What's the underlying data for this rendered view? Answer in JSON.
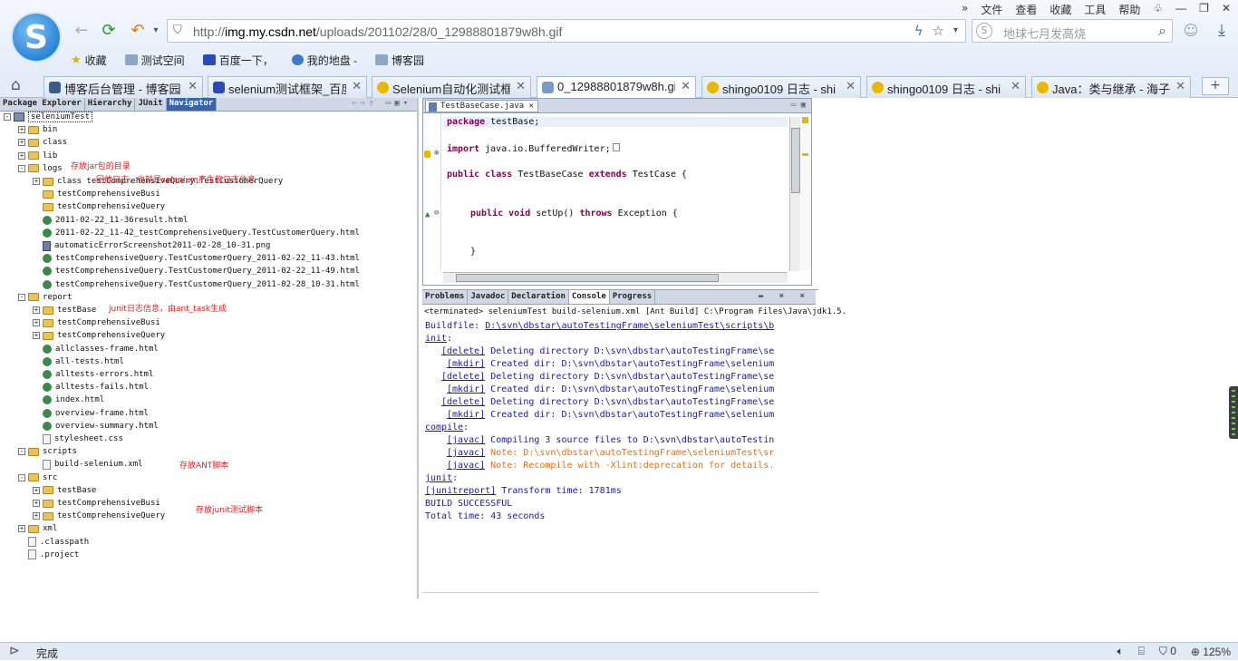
{
  "menu": {
    "items": [
      "文件",
      "查看",
      "收藏",
      "工具",
      "帮助"
    ]
  },
  "address": {
    "host_prefix": "http://",
    "host": "img.my.csdn.net",
    "path": "/uploads/201102/28/0_12988801879w8h.gif"
  },
  "search": {
    "placeholder": "地球七月发高烧"
  },
  "favorites": [
    "收藏",
    "测试空间",
    "百度一下，",
    "我的地盘 -",
    "博客园"
  ],
  "tabs": [
    {
      "label": "博客后台管理 - 博客园",
      "icon_color": "#3a5a8a"
    },
    {
      "label": "selenium测试框架_百度",
      "icon_color": "#2a4ab8"
    },
    {
      "label": "Selenium自动化测试框",
      "icon_color": "#e6b800"
    },
    {
      "label": "0_12988801879w8h.gi",
      "icon_color": "#7a9ac8"
    },
    {
      "label": "shingo0109 日志 - shi",
      "icon_color": "#e6b800"
    },
    {
      "label": "shingo0109 日志 - shi",
      "icon_color": "#e6b800"
    },
    {
      "label": "Java：类与继承 - 海子",
      "icon_color": "#e6b800"
    }
  ],
  "eclipse": {
    "left_tabs": [
      "Package Explorer",
      "Hierarchy",
      "JUnit",
      "Navigator"
    ],
    "tree": [
      {
        "label": "seleniumTest",
        "depth": 0,
        "icon": "project",
        "toggle": "-"
      },
      {
        "label": "bin",
        "depth": 1,
        "icon": "folder",
        "toggle": "+"
      },
      {
        "label": "class",
        "depth": 1,
        "icon": "folder",
        "toggle": "+"
      },
      {
        "label": "lib",
        "depth": 1,
        "icon": "folder",
        "toggle": "+"
      },
      {
        "label": "logs",
        "depth": 1,
        "icon": "folder",
        "toggle": "-"
      },
      {
        "label": "class testComprehensiveQuery.TestCustomerQuery",
        "depth": 2,
        "icon": "folder",
        "toggle": "+"
      },
      {
        "label": "testComprehensiveBusi",
        "depth": 2,
        "icon": "folder",
        "toggle": ""
      },
      {
        "label": "testComprehensiveQuery",
        "depth": 2,
        "icon": "folder",
        "toggle": ""
      },
      {
        "label": "2011-02-22_11-36result.html",
        "depth": 2,
        "icon": "globe",
        "toggle": ""
      },
      {
        "label": "2011-02-22_11-42_testComprehensiveQuery.TestCustomerQuery.html",
        "depth": 2,
        "icon": "globe",
        "toggle": ""
      },
      {
        "label": "automaticErrorScreenshot2011-02-28_10-31.png",
        "depth": 2,
        "icon": "image",
        "toggle": ""
      },
      {
        "label": "testComprehensiveQuery.TestCustomerQuery_2011-02-22_11-43.html",
        "depth": 2,
        "icon": "globe",
        "toggle": ""
      },
      {
        "label": "testComprehensiveQuery.TestCustomerQuery_2011-02-22_11-49.html",
        "depth": 2,
        "icon": "globe",
        "toggle": ""
      },
      {
        "label": "testComprehensiveQuery.TestCustomerQuery_2011-02-28_10-31.html",
        "depth": 2,
        "icon": "globe",
        "toggle": ""
      },
      {
        "label": "report",
        "depth": 1,
        "icon": "folder",
        "toggle": "-"
      },
      {
        "label": "testBase",
        "depth": 2,
        "icon": "folder",
        "toggle": "+"
      },
      {
        "label": "testComprehensiveBusi",
        "depth": 2,
        "icon": "folder",
        "toggle": "+"
      },
      {
        "label": "testComprehensiveQuery",
        "depth": 2,
        "icon": "folder",
        "toggle": "+"
      },
      {
        "label": "allclasses-frame.html",
        "depth": 2,
        "icon": "globe",
        "toggle": ""
      },
      {
        "label": "all-tests.html",
        "depth": 2,
        "icon": "globe",
        "toggle": ""
      },
      {
        "label": "alltests-errors.html",
        "depth": 2,
        "icon": "globe",
        "toggle": ""
      },
      {
        "label": "alltests-fails.html",
        "depth": 2,
        "icon": "globe",
        "toggle": ""
      },
      {
        "label": "index.html",
        "depth": 2,
        "icon": "globe",
        "toggle": ""
      },
      {
        "label": "overview-frame.html",
        "depth": 2,
        "icon": "globe",
        "toggle": ""
      },
      {
        "label": "overview-summary.html",
        "depth": 2,
        "icon": "globe",
        "toggle": ""
      },
      {
        "label": "stylesheet.css",
        "depth": 2,
        "icon": "file",
        "toggle": ""
      },
      {
        "label": "scripts",
        "depth": 1,
        "icon": "folder",
        "toggle": "-"
      },
      {
        "label": "build-selenium.xml",
        "depth": 2,
        "icon": "file",
        "toggle": ""
      },
      {
        "label": "src",
        "depth": 1,
        "icon": "folder",
        "toggle": "-"
      },
      {
        "label": "testBase",
        "depth": 2,
        "icon": "folder",
        "toggle": "+"
      },
      {
        "label": "testComprehensiveBusi",
        "depth": 2,
        "icon": "folder",
        "toggle": "+"
      },
      {
        "label": "testComprehensiveQuery",
        "depth": 2,
        "icon": "folder",
        "toggle": "+"
      },
      {
        "label": "xml",
        "depth": 1,
        "icon": "folder",
        "toggle": "+"
      },
      {
        "label": ".classpath",
        "depth": 1,
        "icon": "file",
        "toggle": ""
      },
      {
        "label": ".project",
        "depth": 1,
        "icon": "file",
        "toggle": ""
      }
    ],
    "notes": [
      "存放jar包的目录",
      "回放日志，也就是selenium产生的日志信息",
      "junit日志信息，由ant_task生成",
      "存放ANT脚本",
      "存放junit测试脚本"
    ],
    "editor_tab": "TestBaseCase.java",
    "code": {
      "l1_kw": "package",
      "l1_rest": " testBase;",
      "l2_kw": "import",
      "l2_rest": " java.io.BufferedWriter;",
      "l3_kw1": "public",
      "l3_kw2": "class",
      "l3_mid": " TestBaseCase ",
      "l3_kw3": "extends",
      "l3_rest": " TestCase {",
      "l4_kw1": "public",
      "l4_kw2": "void",
      "l4_mid": " setUp() ",
      "l4_kw3": "throws",
      "l4_rest": " Exception {",
      "l5": "}"
    },
    "console_tabs": [
      "Problems",
      "Javadoc",
      "Declaration",
      "Console",
      "Progress"
    ],
    "console_header": "<terminated> seleniumTest build-selenium.xml [Ant Build] C:\\Program Files\\Java\\jdk1.5.",
    "console": {
      "buildfile_label": "Buildfile: ",
      "buildfile_path": "D:\\svn\\dbstar\\autoTestingFrame\\seleniumTest\\scripts\\b",
      "init": "init",
      "delete": "[delete]",
      "mkdir": "[mkdir]",
      "del_msg": " Deleting directory D:\\svn\\dbstar\\autoTestingFrame\\se",
      "mk_msg": " Created dir: D:\\svn\\dbstar\\autoTestingFrame\\selenium",
      "compile": "compile",
      "javac": "[javac]",
      "javac1": " Compiling 3 source files to D:\\svn\\dbstar\\autoTestin",
      "javac2": " Note: D:\\svn\\dbstar\\autoTestingFrame\\seleniumTest\\sr",
      "javac3": " Note: Recompile with -Xlint:deprecation for details.",
      "junit": "junit",
      "junitreport": "[junitreport]",
      "jr_msg": " Transform time: 1781ms",
      "success": "BUILD SUCCESSFUL",
      "total": "Total time: 43 seconds"
    }
  },
  "status": {
    "text": "完成",
    "count": "0",
    "zoom": "125%"
  }
}
